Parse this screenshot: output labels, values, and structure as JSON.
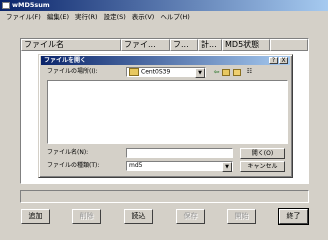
{
  "window": {
    "title": "wMD5sum"
  },
  "menu": [
    "ファイル(F)",
    "編集(E)",
    "実行(R)",
    "設定(S)",
    "表示(V)",
    "ヘルプ(H)"
  ],
  "list": {
    "columns": [
      "ファイル名",
      "ファイ...",
      "フ...",
      "計...",
      "MD5状態"
    ]
  },
  "buttons": {
    "add": "追加",
    "delete": "削除",
    "read": "読込",
    "save": "保存",
    "open": "開始",
    "exit": "終了"
  },
  "dialog": {
    "title": "ファイルを開く",
    "help": "?",
    "close": "X",
    "location_label": "ファイルの場所(I):",
    "location_value": "Cent0S39",
    "filename_label": "ファイル名(N):",
    "filename_value": "",
    "filetype_label": "ファイルの種類(T):",
    "filetype_value": "md5",
    "open_button": "開く(O)",
    "cancel_button": "キャンセル"
  }
}
